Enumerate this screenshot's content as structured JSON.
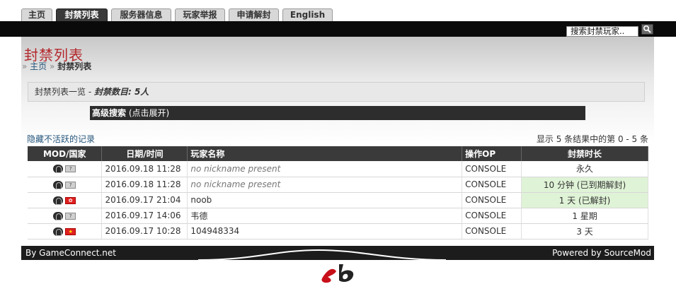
{
  "tabs": [
    {
      "label": "主页",
      "active": false
    },
    {
      "label": "封禁列表",
      "active": true
    },
    {
      "label": "服务器信息",
      "active": false
    },
    {
      "label": "玩家举报",
      "active": false
    },
    {
      "label": "申请解封",
      "active": false
    },
    {
      "label": "English",
      "active": false
    }
  ],
  "search": {
    "text": "搜索封禁玩家..",
    "icon": "search-icon"
  },
  "page": {
    "title": "封禁列表"
  },
  "breadcrumb": {
    "sep": "»",
    "home": "主页",
    "current": "封禁列表"
  },
  "list_header": {
    "label": "封禁列表一览 - ",
    "count": "封禁数目: 5人"
  },
  "advanced_search": {
    "label": "高级搜索",
    "hint": " (点击展开)"
  },
  "hide_inactive": "隐藏不活跃的记录",
  "result_count": "显示 5 条结果中的第 0 - 5 条",
  "table": {
    "headers": [
      "MOD/国家",
      "日期/时间",
      "玩家名称",
      "操作OP",
      "封禁时长"
    ],
    "rows": [
      {
        "flag": "unknown",
        "date": "2016.09.18 11:28",
        "name": "no nickname present",
        "op": "CONSOLE",
        "length": "永久",
        "expired": false
      },
      {
        "flag": "unknown",
        "date": "2016.09.18 11:28",
        "name": "no nickname present",
        "op": "CONSOLE",
        "length": "10 分钟 (已到期解封)",
        "expired": true
      },
      {
        "flag": "hk",
        "date": "2016.09.17 21:04",
        "name": "noob",
        "op": "CONSOLE",
        "length": "1 天 (已解封)",
        "expired": true
      },
      {
        "flag": "unknown",
        "date": "2016.09.17 14:06",
        "name": "韦德",
        "op": "CONSOLE",
        "length": "1 星期",
        "expired": false
      },
      {
        "flag": "cn",
        "date": "2016.09.17 10:28",
        "name": "104948334",
        "op": "CONSOLE",
        "length": "3 天",
        "expired": false
      }
    ]
  },
  "footer": {
    "left": "By GameConnect.net",
    "right": "Powered by SourceMod"
  },
  "colors": {
    "title": "#b3262a",
    "expired_bg": "#dff3d6",
    "header_bg": "#3a3a3a"
  }
}
